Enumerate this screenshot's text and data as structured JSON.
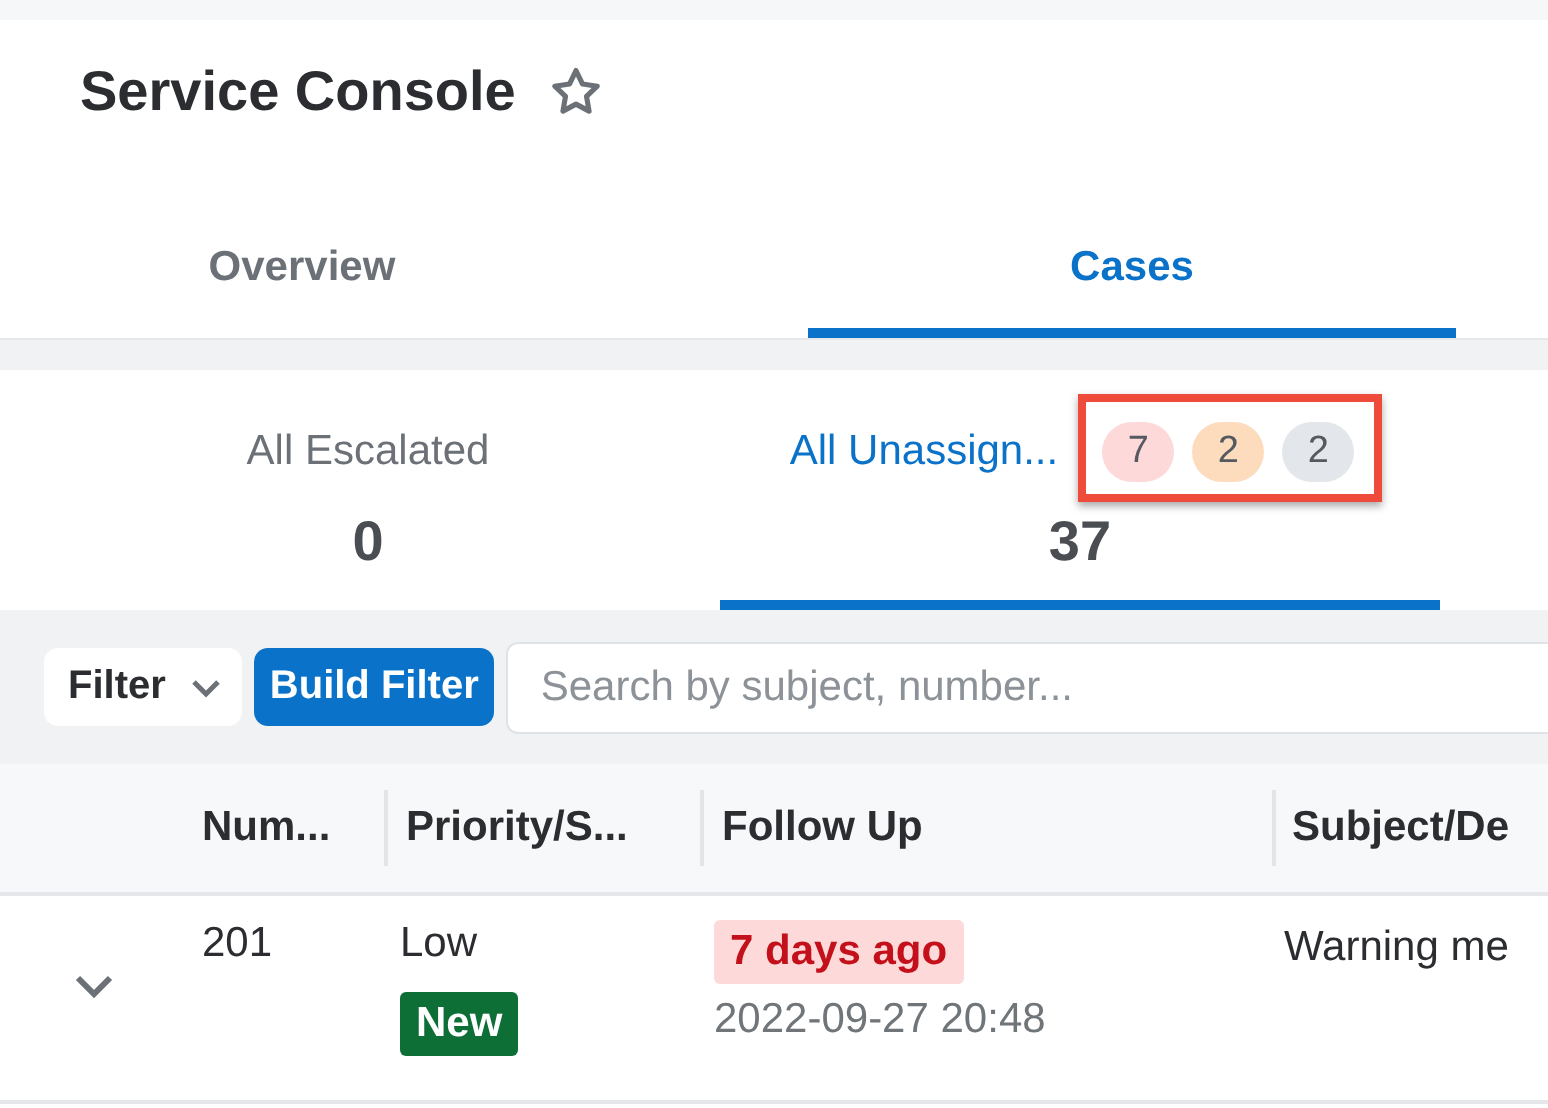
{
  "header": {
    "title": "Service Console",
    "favorite": false
  },
  "tabs": [
    {
      "label": "Overview",
      "selected": false
    },
    {
      "label": "Cases",
      "selected": true
    }
  ],
  "saved_filters": [
    {
      "label": "All Escalated",
      "count": "0",
      "selected": false
    },
    {
      "label": "All Unassign...",
      "count": "37",
      "selected": true,
      "highlighted": true,
      "counters": [
        {
          "value": "7",
          "color": "#fdd9d9"
        },
        {
          "value": "2",
          "color": "#fcdcbd"
        },
        {
          "value": "2",
          "color": "#e3e6ea"
        }
      ]
    }
  ],
  "filter_bar": {
    "filter_label": "Filter",
    "build_filter": "Build Filter",
    "search": {
      "placeholder": "Search by subject, number..."
    }
  },
  "table": {
    "columns": [
      "Num...",
      "Priority/S...",
      "Follow Up",
      "Subject/De"
    ],
    "rows": [
      {
        "expanded": false,
        "number": "201",
        "priority": "Low",
        "status": "New",
        "follow_up": "7 days ago",
        "overdue": true,
        "follow_up_date": "2022-09-27 20:48",
        "subject": "Warning me"
      }
    ]
  }
}
